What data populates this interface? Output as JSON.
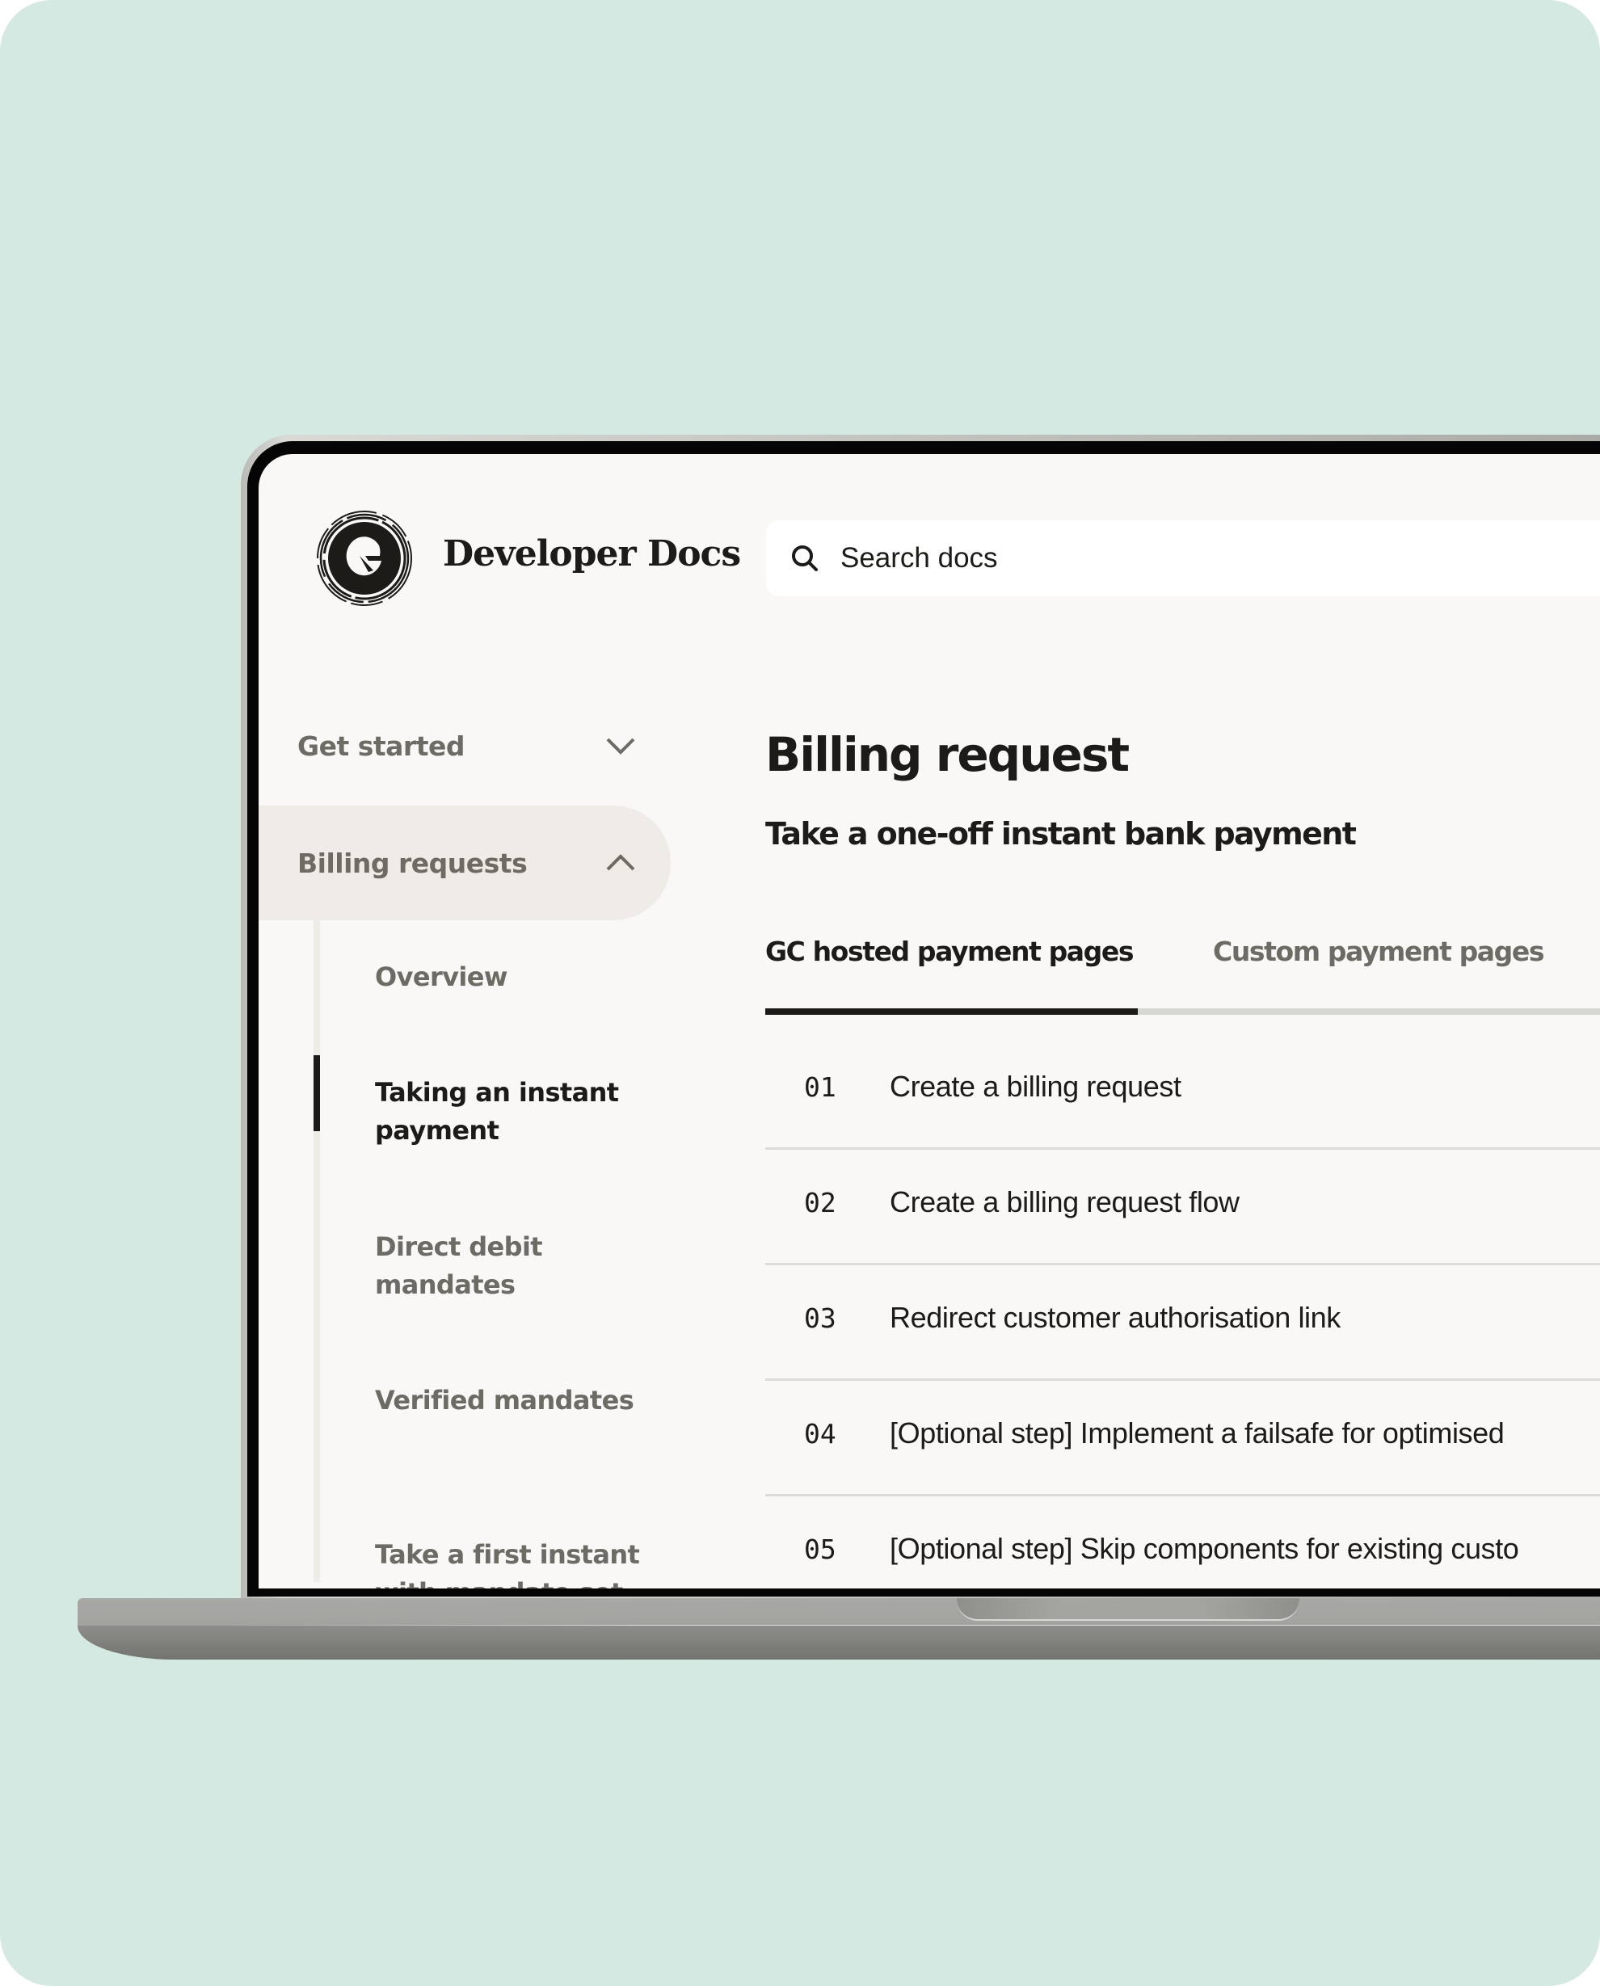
{
  "colors": {
    "background": "#d4e9e2",
    "screen": "#f9f8f6",
    "text_primary": "#1c1b18",
    "text_muted": "#6e6a64",
    "nav_active_bg": "#efece8",
    "divider": "#dcdcd8"
  },
  "header": {
    "logo_icon": "gocardless-spiral-logo",
    "title": "Developer Docs",
    "search": {
      "icon": "search-icon",
      "placeholder": "Search docs",
      "value": ""
    }
  },
  "sidebar": {
    "sections": [
      {
        "label": "Get started",
        "expanded": false,
        "icon": "chevron-down-icon"
      },
      {
        "label": "Billing requests",
        "expanded": true,
        "icon": "chevron-up-icon"
      }
    ],
    "sub_items": [
      {
        "label": "Overview",
        "active": false
      },
      {
        "label": "Taking an instant payment",
        "active": true
      },
      {
        "label": "Direct debit mandates",
        "active": false
      },
      {
        "label": "Verified mandates",
        "active": false
      },
      {
        "label": "Take a first instant with mandate set",
        "active": false
      }
    ]
  },
  "main": {
    "title": "Billing request",
    "subtitle": "Take a one-off instant bank payment",
    "tabs": [
      {
        "label": "GC hosted payment pages",
        "active": true
      },
      {
        "label": "Custom payment pages",
        "active": false
      }
    ],
    "steps": [
      {
        "number": "01",
        "text": "Create a billing request"
      },
      {
        "number": "02",
        "text": "Create a billing request flow"
      },
      {
        "number": "03",
        "text": "Redirect customer authorisation link"
      },
      {
        "number": "04",
        "text": "[Optional step] Implement a failsafe for optimised"
      },
      {
        "number": "05",
        "text": "[Optional step] Skip components for existing custo"
      }
    ]
  }
}
